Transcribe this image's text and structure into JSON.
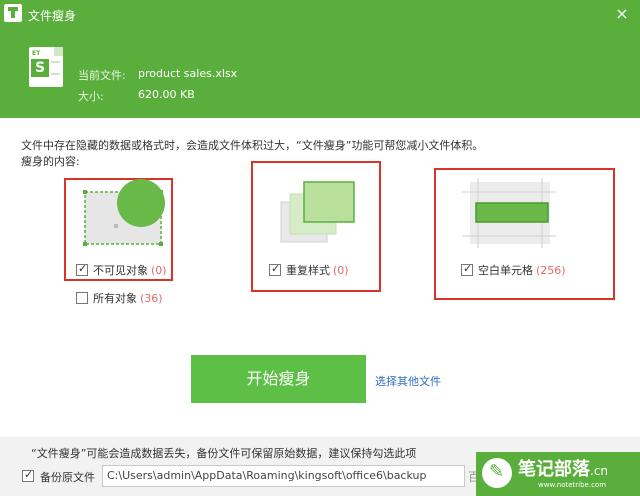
{
  "window": {
    "title": "文件瘦身",
    "close_glyph": "×"
  },
  "file": {
    "icon_badge": "ET",
    "icon_letter": "S",
    "current_label": "当前文件:",
    "current_value": "product sales.xlsx",
    "size_label": "大小:",
    "size_value": "620.00 KB"
  },
  "description": "文件中存在隐藏的数据或格式时，会造成文件体积过大，“文件瘦身”功能可帮您减小文件体积。",
  "content_label": "瘦身的内容:",
  "options": [
    {
      "label": "不可见对象",
      "count": "(0)",
      "checked": true
    },
    {
      "label": "所有对象",
      "count": "(36)",
      "checked": false
    },
    {
      "label": "重复样式",
      "count": "(0)",
      "checked": true
    },
    {
      "label": "空白单元格",
      "count": "(256)",
      "checked": true
    }
  ],
  "start_button": "开始瘦身",
  "other_link": "选择其他文件",
  "warning": "“文件瘦身”可能会造成数据丢失，备份文件可保留原始数据，建议保持勾选此项",
  "backup": {
    "label": "备份原文件",
    "checked": true,
    "path": "C:\\Users\\admin\\AppData\\Roaming\\kingsoft\\office6\\backup"
  },
  "partial_text": "百",
  "watermark": {
    "title": "笔记部落",
    "suffix": ".cn",
    "url": "www.notetribe.com"
  },
  "colors": {
    "header": "#5aaf3c",
    "button": "#5dbf45",
    "highlight_box": "#d9342b",
    "link": "#2f6fc0",
    "count": "#e06a6a"
  }
}
